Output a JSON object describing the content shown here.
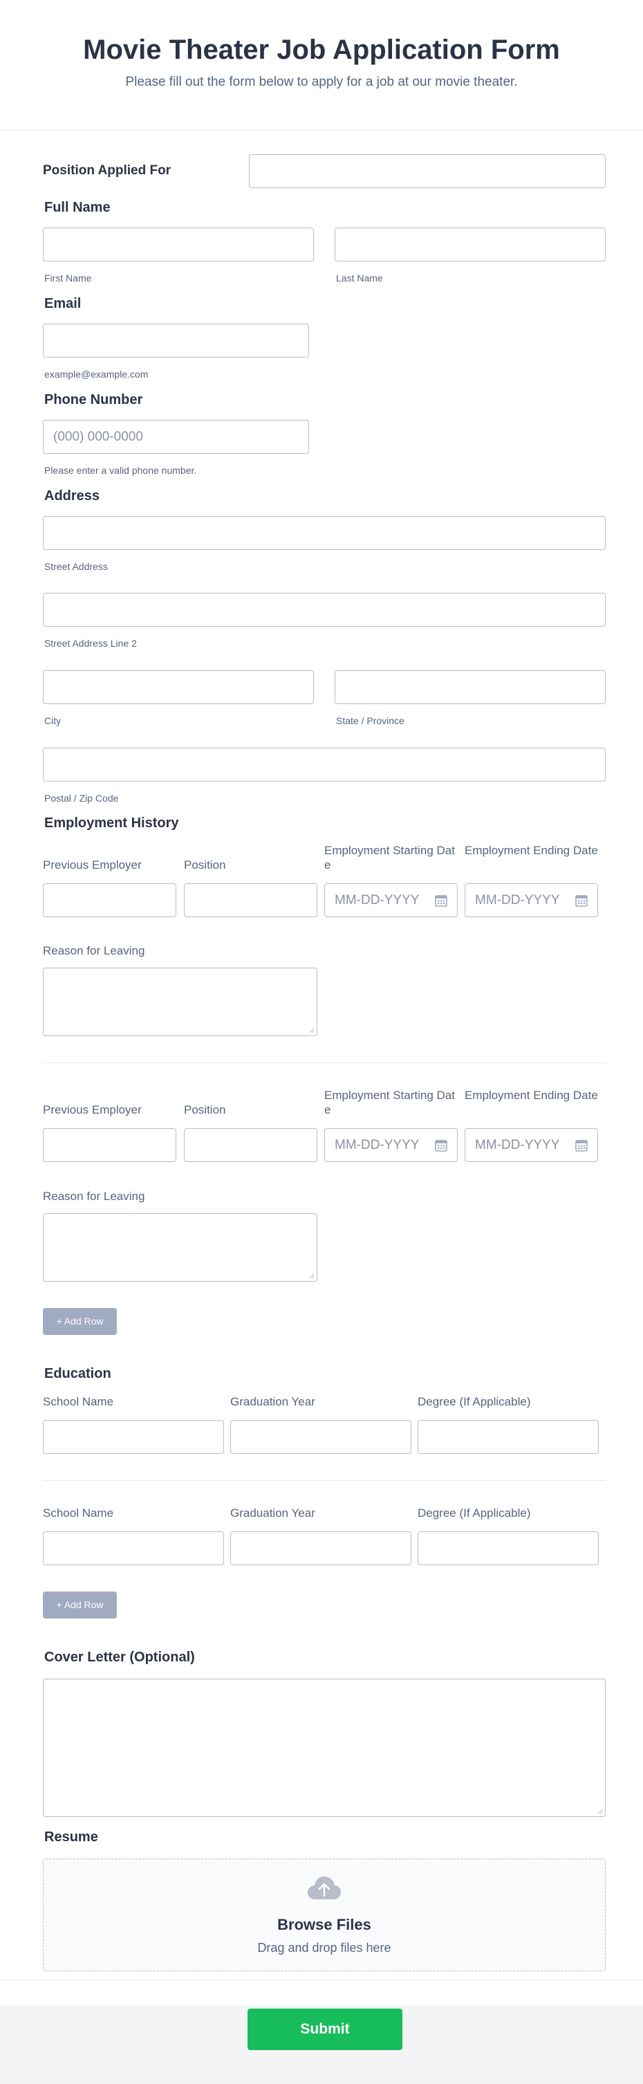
{
  "header": {
    "title": "Movie Theater Job Application Form",
    "subtitle": "Please fill out the form below to apply for a job at our movie theater."
  },
  "position": {
    "label": "Position Applied For",
    "value": ""
  },
  "full_name": {
    "label": "Full Name",
    "first_sublabel": "First Name",
    "last_sublabel": "Last Name"
  },
  "email": {
    "label": "Email",
    "sublabel": "example@example.com"
  },
  "phone": {
    "label": "Phone Number",
    "placeholder": "(000) 000-0000",
    "sublabel": "Please enter a valid phone number."
  },
  "address": {
    "label": "Address",
    "street": "Street Address",
    "street2": "Street Address Line 2",
    "city": "City",
    "state": "State / Province",
    "postal": "Postal / Zip Code"
  },
  "employment": {
    "label": "Employment History",
    "columns": [
      "Previous Employer",
      "Position",
      "Employment Starting Date",
      "Employment Ending Date"
    ],
    "date_placeholder": "MM-DD-YYYY",
    "reason_label": "Reason for Leaving",
    "add_row": "+ Add Row"
  },
  "education": {
    "label": "Education",
    "columns": [
      "School Name",
      "Graduation Year",
      "Degree (If Applicable)"
    ],
    "add_row": "+ Add Row"
  },
  "cover_letter": {
    "label": "Cover Letter (Optional)"
  },
  "resume": {
    "label": "Resume",
    "browse": "Browse Files",
    "drag": "Drag and drop files here"
  },
  "submit": {
    "label": "Submit"
  },
  "colors": {
    "accent": "#18bd5b",
    "add_row": "#a0aac0",
    "border": "#b8bdc9",
    "text": "#2c3345",
    "muted": "#57647e"
  }
}
